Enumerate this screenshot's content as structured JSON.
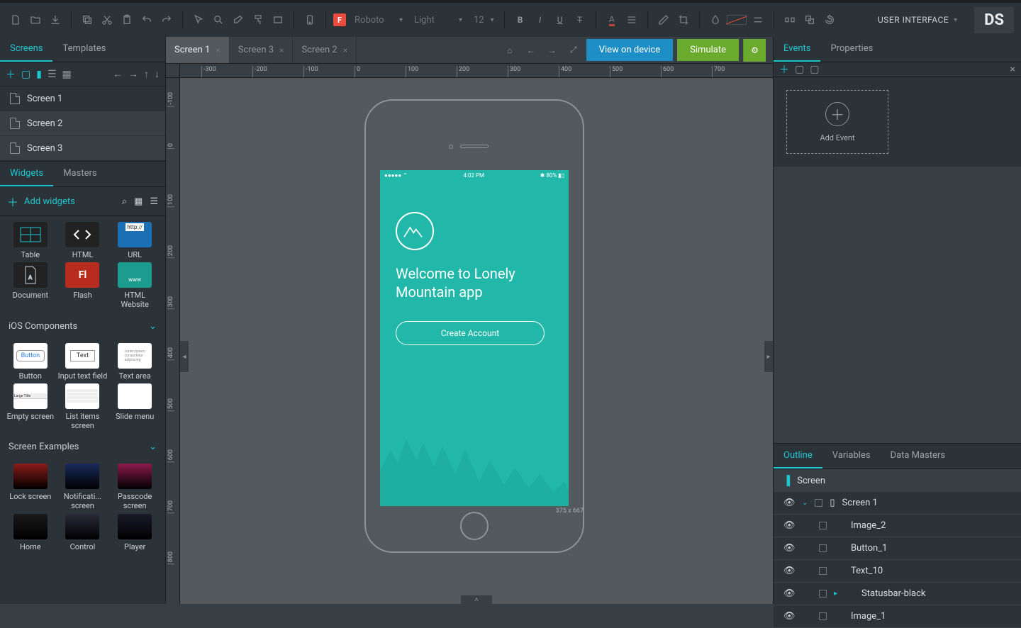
{
  "topbar": {
    "font_family": "Roboto",
    "font_weight": "Light",
    "font_size": "12",
    "user_menu": "USER INTERFACE",
    "logo": "DS",
    "f_badge": "F"
  },
  "left": {
    "tabs": {
      "screens": "Screens",
      "templates": "Templates"
    },
    "screens": [
      "Screen 1",
      "Screen 2",
      "Screen 3"
    ],
    "widgets_tab": "Widgets",
    "masters_tab": "Masters",
    "add_widgets": "Add widgets",
    "basic_widgets": [
      {
        "name": "Table"
      },
      {
        "name": "HTML"
      },
      {
        "name": "URL"
      },
      {
        "name": "Document"
      },
      {
        "name": "Flash"
      },
      {
        "name": "HTML Website"
      }
    ],
    "ios_header": "iOS Components",
    "ios_widgets": [
      {
        "name": "Button"
      },
      {
        "name": "Input text field"
      },
      {
        "name": "Text area"
      },
      {
        "name": "Empty screen"
      },
      {
        "name": "List items screen"
      },
      {
        "name": "Slide menu"
      }
    ],
    "examples_header": "Screen Examples",
    "examples": [
      {
        "name": "Lock screen"
      },
      {
        "name": "Notificati... screen"
      },
      {
        "name": "Passcode screen"
      },
      {
        "name": "Home"
      },
      {
        "name": "Control"
      },
      {
        "name": "Player"
      }
    ]
  },
  "canvas": {
    "tabs": [
      {
        "label": "Screen 1",
        "active": true
      },
      {
        "label": "Screen 3",
        "active": false
      },
      {
        "label": "Screen 2",
        "active": false
      }
    ],
    "view_btn": "View on device",
    "sim_btn": "Simulate",
    "ruler_h": [
      "-300",
      "-200",
      "-100",
      "0",
      "100",
      "200",
      "300",
      "400",
      "500",
      "600",
      "700"
    ],
    "ruler_v": [
      "-100",
      "0",
      "100",
      "200",
      "300",
      "400",
      "500",
      "600",
      "700",
      "800"
    ],
    "dims": "375 x 667",
    "phone": {
      "time": "4:02 PM",
      "signal": "●●●●●  ⌃",
      "battery": "✱ 80%  ▮▯",
      "title": "Welcome to Lonely Mountain app",
      "cta": "Create Account"
    }
  },
  "right": {
    "tabs": {
      "events": "Events",
      "properties": "Properties"
    },
    "add_event": "Add Event",
    "outline_tabs": {
      "outline": "Outline",
      "variables": "Variables",
      "data_masters": "Data Masters"
    },
    "outline_root": "Screen",
    "outline": [
      {
        "label": "Screen 1",
        "expand": true,
        "icon": "device"
      },
      {
        "label": "Image_2"
      },
      {
        "label": "Button_1"
      },
      {
        "label": "Text_10"
      },
      {
        "label": "Statusbar-black",
        "caret": true
      },
      {
        "label": "Image_1"
      }
    ]
  }
}
